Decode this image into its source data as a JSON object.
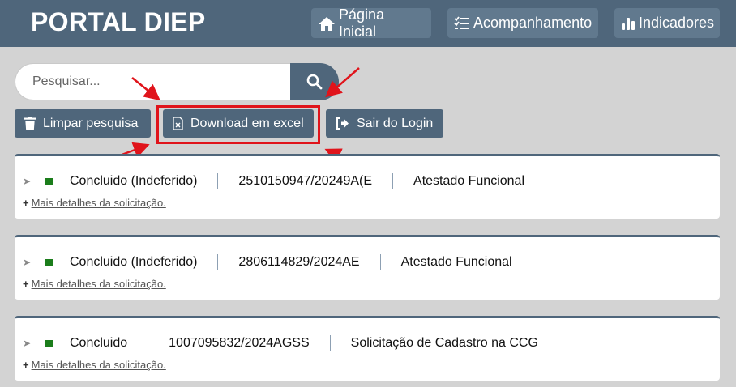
{
  "header": {
    "brand": "PORTAL DIEP",
    "nav": [
      {
        "label": "Página Inicial",
        "icon": "home-icon"
      },
      {
        "label": "Acompanhamento",
        "icon": "checklist-icon"
      },
      {
        "label": "Indicadores",
        "icon": "bar-chart-icon"
      }
    ]
  },
  "search": {
    "placeholder": "Pesquisar...",
    "value": "",
    "button_icon": "search-icon"
  },
  "actions": {
    "clear_label": "Limpar pesquisa",
    "download_label": "Download em excel",
    "logout_label": "Sair do Login"
  },
  "colors": {
    "primary": "#4f667b",
    "nav_button": "#61798e",
    "background": "#d3d3d3",
    "status_ok": "#1b7d1b",
    "annotation_red": "#e0141b"
  },
  "requests": [
    {
      "status": "Concluido (Indeferido)",
      "protocol": "2510150947/20249A(E",
      "type": "Atestado Funcional",
      "details": "Mais detalhes da solicitação."
    },
    {
      "status": "Concluido (Indeferido)",
      "protocol": "2806114829/2024AE",
      "type": "Atestado Funcional",
      "details": "Mais detalhes da solicitação."
    },
    {
      "status": "Concluido",
      "protocol": "1007095832/2024AGSS",
      "type": "Solicitação de Cadastro na CCG",
      "details": "Mais detalhes da solicitação."
    }
  ]
}
